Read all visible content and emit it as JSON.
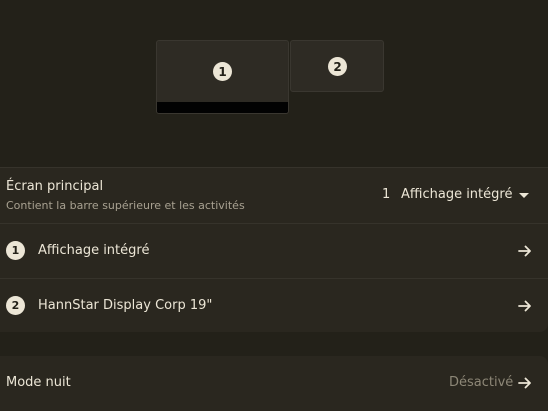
{
  "arrangement": {
    "monitors": [
      {
        "number": "1"
      },
      {
        "number": "2"
      }
    ]
  },
  "primary_display": {
    "title": "Écran principal",
    "subtitle": "Contient la barre supérieure et les activités",
    "selected_number": "1",
    "selected_value": "Affichage intégré"
  },
  "displays": [
    {
      "number": "1",
      "label": "Affichage intégré"
    },
    {
      "number": "2",
      "label": "HannStar Display Corp 19\""
    }
  ],
  "night_mode": {
    "label": "Mode nuit",
    "value": "Désactivé"
  },
  "colors": {
    "background": "#232119",
    "panel": "#2a271f",
    "text": "#ece6d6",
    "muted": "#a8a191",
    "top_bar": "#020202"
  },
  "icons": {
    "row_action": "arrow-right-icon",
    "dropdown": "caret-down-icon"
  }
}
